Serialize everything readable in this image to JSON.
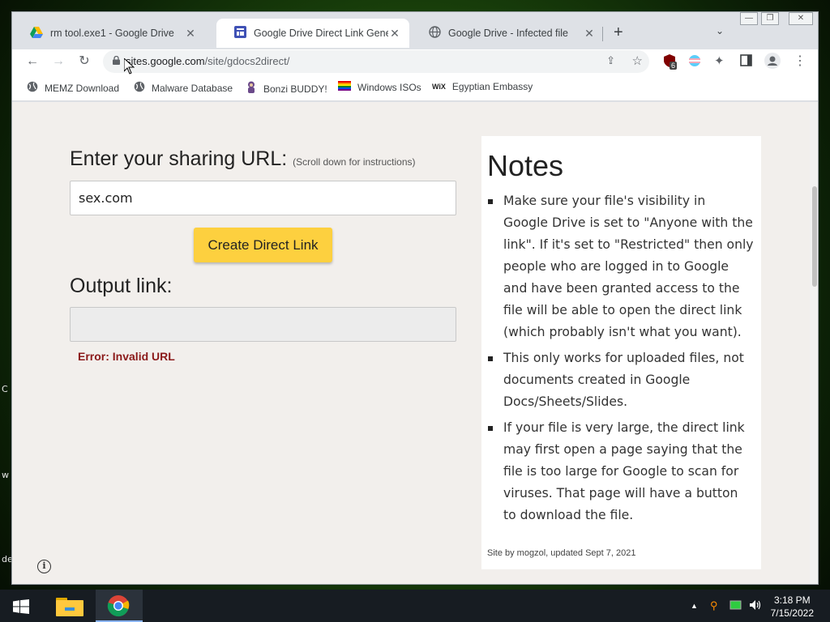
{
  "window": {
    "tabs": [
      {
        "title": "rm tool.exe1 - Google Drive",
        "favicon": "google-drive-icon",
        "active": false
      },
      {
        "title": "Google Drive Direct Link Generator",
        "favicon": "google-sites-icon",
        "active": true
      },
      {
        "title": "Google Drive - Infected file",
        "favicon": "globe-icon",
        "active": false
      }
    ],
    "new_tab_label": "+",
    "tab_search_label": "⌄",
    "controls": {
      "minimize": "—",
      "restore": "❐",
      "close": "✕"
    }
  },
  "toolbar": {
    "url_host": "sites.google.com",
    "url_path": "/site/gdocs2direct/",
    "extension_badge": "6"
  },
  "bookmarks": [
    {
      "label": "MEMZ Download",
      "icon": "globe-icon"
    },
    {
      "label": "Malware Database",
      "icon": "globe-icon"
    },
    {
      "label": "Bonzi BUDDY!",
      "icon": "bonzi-icon"
    },
    {
      "label": "Windows ISOs",
      "icon": "rainbow-flag-icon"
    },
    {
      "label": "Egyptian Embassy",
      "icon": "wix-icon"
    }
  ],
  "page": {
    "heading": "Enter your sharing URL:",
    "heading_hint": "(Scroll down for instructions)",
    "input_value": "sex.com",
    "create_button": "Create Direct Link",
    "output_label": "Output link:",
    "output_value": "",
    "error": "Error: Invalid URL"
  },
  "notes": {
    "title": "Notes",
    "items": [
      "Make sure your file's visibility in Google Drive is set to \"Anyone with the link\". If it's set to \"Restricted\" then only people who are logged in to Google and have been granted access to the file will be able to open the direct link (which probably isn't what you want).",
      "This only works for uploaded files, not documents created in Google Docs/Sheets/Slides.",
      "If your file is very large, the direct link may first open a page saying that the file is too large for Google to scan for viruses. That page will have a button to download the file."
    ],
    "credit": "Site by mogzol, updated Sept 7, 2021"
  },
  "desktop": {
    "partial_labels": [
      "C",
      "w",
      "de"
    ]
  },
  "taskbar": {
    "time": "3:18 PM",
    "date": "7/15/2022",
    "tray_chevron": "▲"
  },
  "colors": {
    "accent_button": "#fdd03f",
    "error": "#8b1a1a",
    "page_background": "#f2efec"
  }
}
